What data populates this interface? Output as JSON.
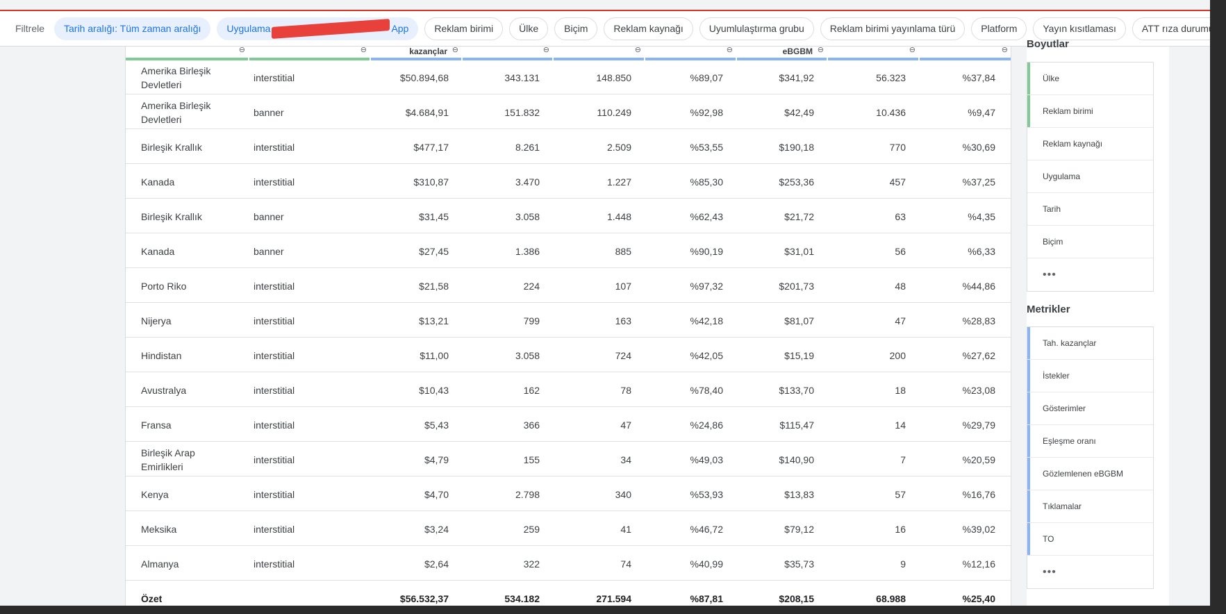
{
  "filters": {
    "label": "Filtrele",
    "chips": [
      {
        "label": "Tarih aralığı: Tüm zaman aralığı",
        "active": true
      },
      {
        "label_start": "Uygulama",
        "label_end": "App",
        "active": true,
        "redacted": true
      },
      {
        "label": "Reklam birimi",
        "active": false
      },
      {
        "label": "Ülke",
        "active": false
      },
      {
        "label": "Biçim",
        "active": false
      },
      {
        "label": "Reklam kaynağı",
        "active": false
      },
      {
        "label": "Uyumlulaştırma grubu",
        "active": false
      },
      {
        "label": "Reklam birimi yayınlama türü",
        "active": false
      },
      {
        "label": "Platform",
        "active": false
      },
      {
        "label": "Yayın kısıtlaması",
        "active": false
      },
      {
        "label": "ATT rıza durumu",
        "active": false
      }
    ]
  },
  "table": {
    "header_visible": [
      "",
      "",
      "kazançlar",
      "",
      "",
      "",
      "eBGBM",
      "",
      ""
    ],
    "header_colors": [
      "#81c995",
      "#81c995",
      "#8ab4f8",
      "#8ab4f8",
      "#8ab4f8",
      "#8ab4f8",
      "#8ab4f8",
      "#8ab4f8",
      "#8ab4f8"
    ],
    "rows": [
      [
        "Amerika Birleşik Devletleri",
        "interstitial",
        "$50.894,68",
        "343.131",
        "148.850",
        "%89,07",
        "$341,92",
        "56.323",
        "%37,84"
      ],
      [
        "Amerika Birleşik Devletleri",
        "banner",
        "$4.684,91",
        "151.832",
        "110.249",
        "%92,98",
        "$42,49",
        "10.436",
        "%9,47"
      ],
      [
        "Birleşik Krallık",
        "interstitial",
        "$477,17",
        "8.261",
        "2.509",
        "%53,55",
        "$190,18",
        "770",
        "%30,69"
      ],
      [
        "Kanada",
        "interstitial",
        "$310,87",
        "3.470",
        "1.227",
        "%85,30",
        "$253,36",
        "457",
        "%37,25"
      ],
      [
        "Birleşik Krallık",
        "banner",
        "$31,45",
        "3.058",
        "1.448",
        "%62,43",
        "$21,72",
        "63",
        "%4,35"
      ],
      [
        "Kanada",
        "banner",
        "$27,45",
        "1.386",
        "885",
        "%90,19",
        "$31,01",
        "56",
        "%6,33"
      ],
      [
        "Porto Riko",
        "interstitial",
        "$21,58",
        "224",
        "107",
        "%97,32",
        "$201,73",
        "48",
        "%44,86"
      ],
      [
        "Nijerya",
        "interstitial",
        "$13,21",
        "799",
        "163",
        "%42,18",
        "$81,07",
        "47",
        "%28,83"
      ],
      [
        "Hindistan",
        "interstitial",
        "$11,00",
        "3.058",
        "724",
        "%42,05",
        "$15,19",
        "200",
        "%27,62"
      ],
      [
        "Avustralya",
        "interstitial",
        "$10,43",
        "162",
        "78",
        "%78,40",
        "$133,70",
        "18",
        "%23,08"
      ],
      [
        "Fransa",
        "interstitial",
        "$5,43",
        "366",
        "47",
        "%24,86",
        "$115,47",
        "14",
        "%29,79"
      ],
      [
        "Birleşik Arap Emirlikleri",
        "interstitial",
        "$4,79",
        "155",
        "34",
        "%49,03",
        "$140,90",
        "7",
        "%20,59"
      ],
      [
        "Kenya",
        "interstitial",
        "$4,70",
        "2.798",
        "340",
        "%53,93",
        "$13,83",
        "57",
        "%16,76"
      ],
      [
        "Meksika",
        "interstitial",
        "$3,24",
        "259",
        "41",
        "%46,72",
        "$79,12",
        "16",
        "%39,02"
      ],
      [
        "Almanya",
        "interstitial",
        "$2,64",
        "322",
        "74",
        "%40,99",
        "$35,73",
        "9",
        "%12,16"
      ]
    ],
    "summary": [
      "Özet",
      "",
      "$56.532,37",
      "534.182",
      "271.594",
      "%87,81",
      "$208,15",
      "68.988",
      "%25,40"
    ]
  },
  "sidebar": {
    "dimensions_title": "Boyutlar",
    "dimensions": [
      {
        "label": "Ülke",
        "selected": true
      },
      {
        "label": "Reklam birimi",
        "selected": true
      },
      {
        "label": "Reklam kaynağı",
        "selected": false
      },
      {
        "label": "Uygulama",
        "selected": false
      },
      {
        "label": "Tarih",
        "selected": false
      },
      {
        "label": "Biçim",
        "selected": false
      }
    ],
    "metrics_title": "Metrikler",
    "metrics": [
      {
        "label": "Tah. kazançlar",
        "selected": true
      },
      {
        "label": "İstekler",
        "selected": true
      },
      {
        "label": "Gösterimler",
        "selected": true
      },
      {
        "label": "Eşleşme oranı",
        "selected": true
      },
      {
        "label": "Gözlemlenen eBGBM",
        "selected": true
      },
      {
        "label": "Tıklamalar",
        "selected": true
      },
      {
        "label": "TO",
        "selected": true
      }
    ],
    "more_label": "•••",
    "accent_green": "#81c995",
    "accent_blue": "#8ab4f8"
  }
}
